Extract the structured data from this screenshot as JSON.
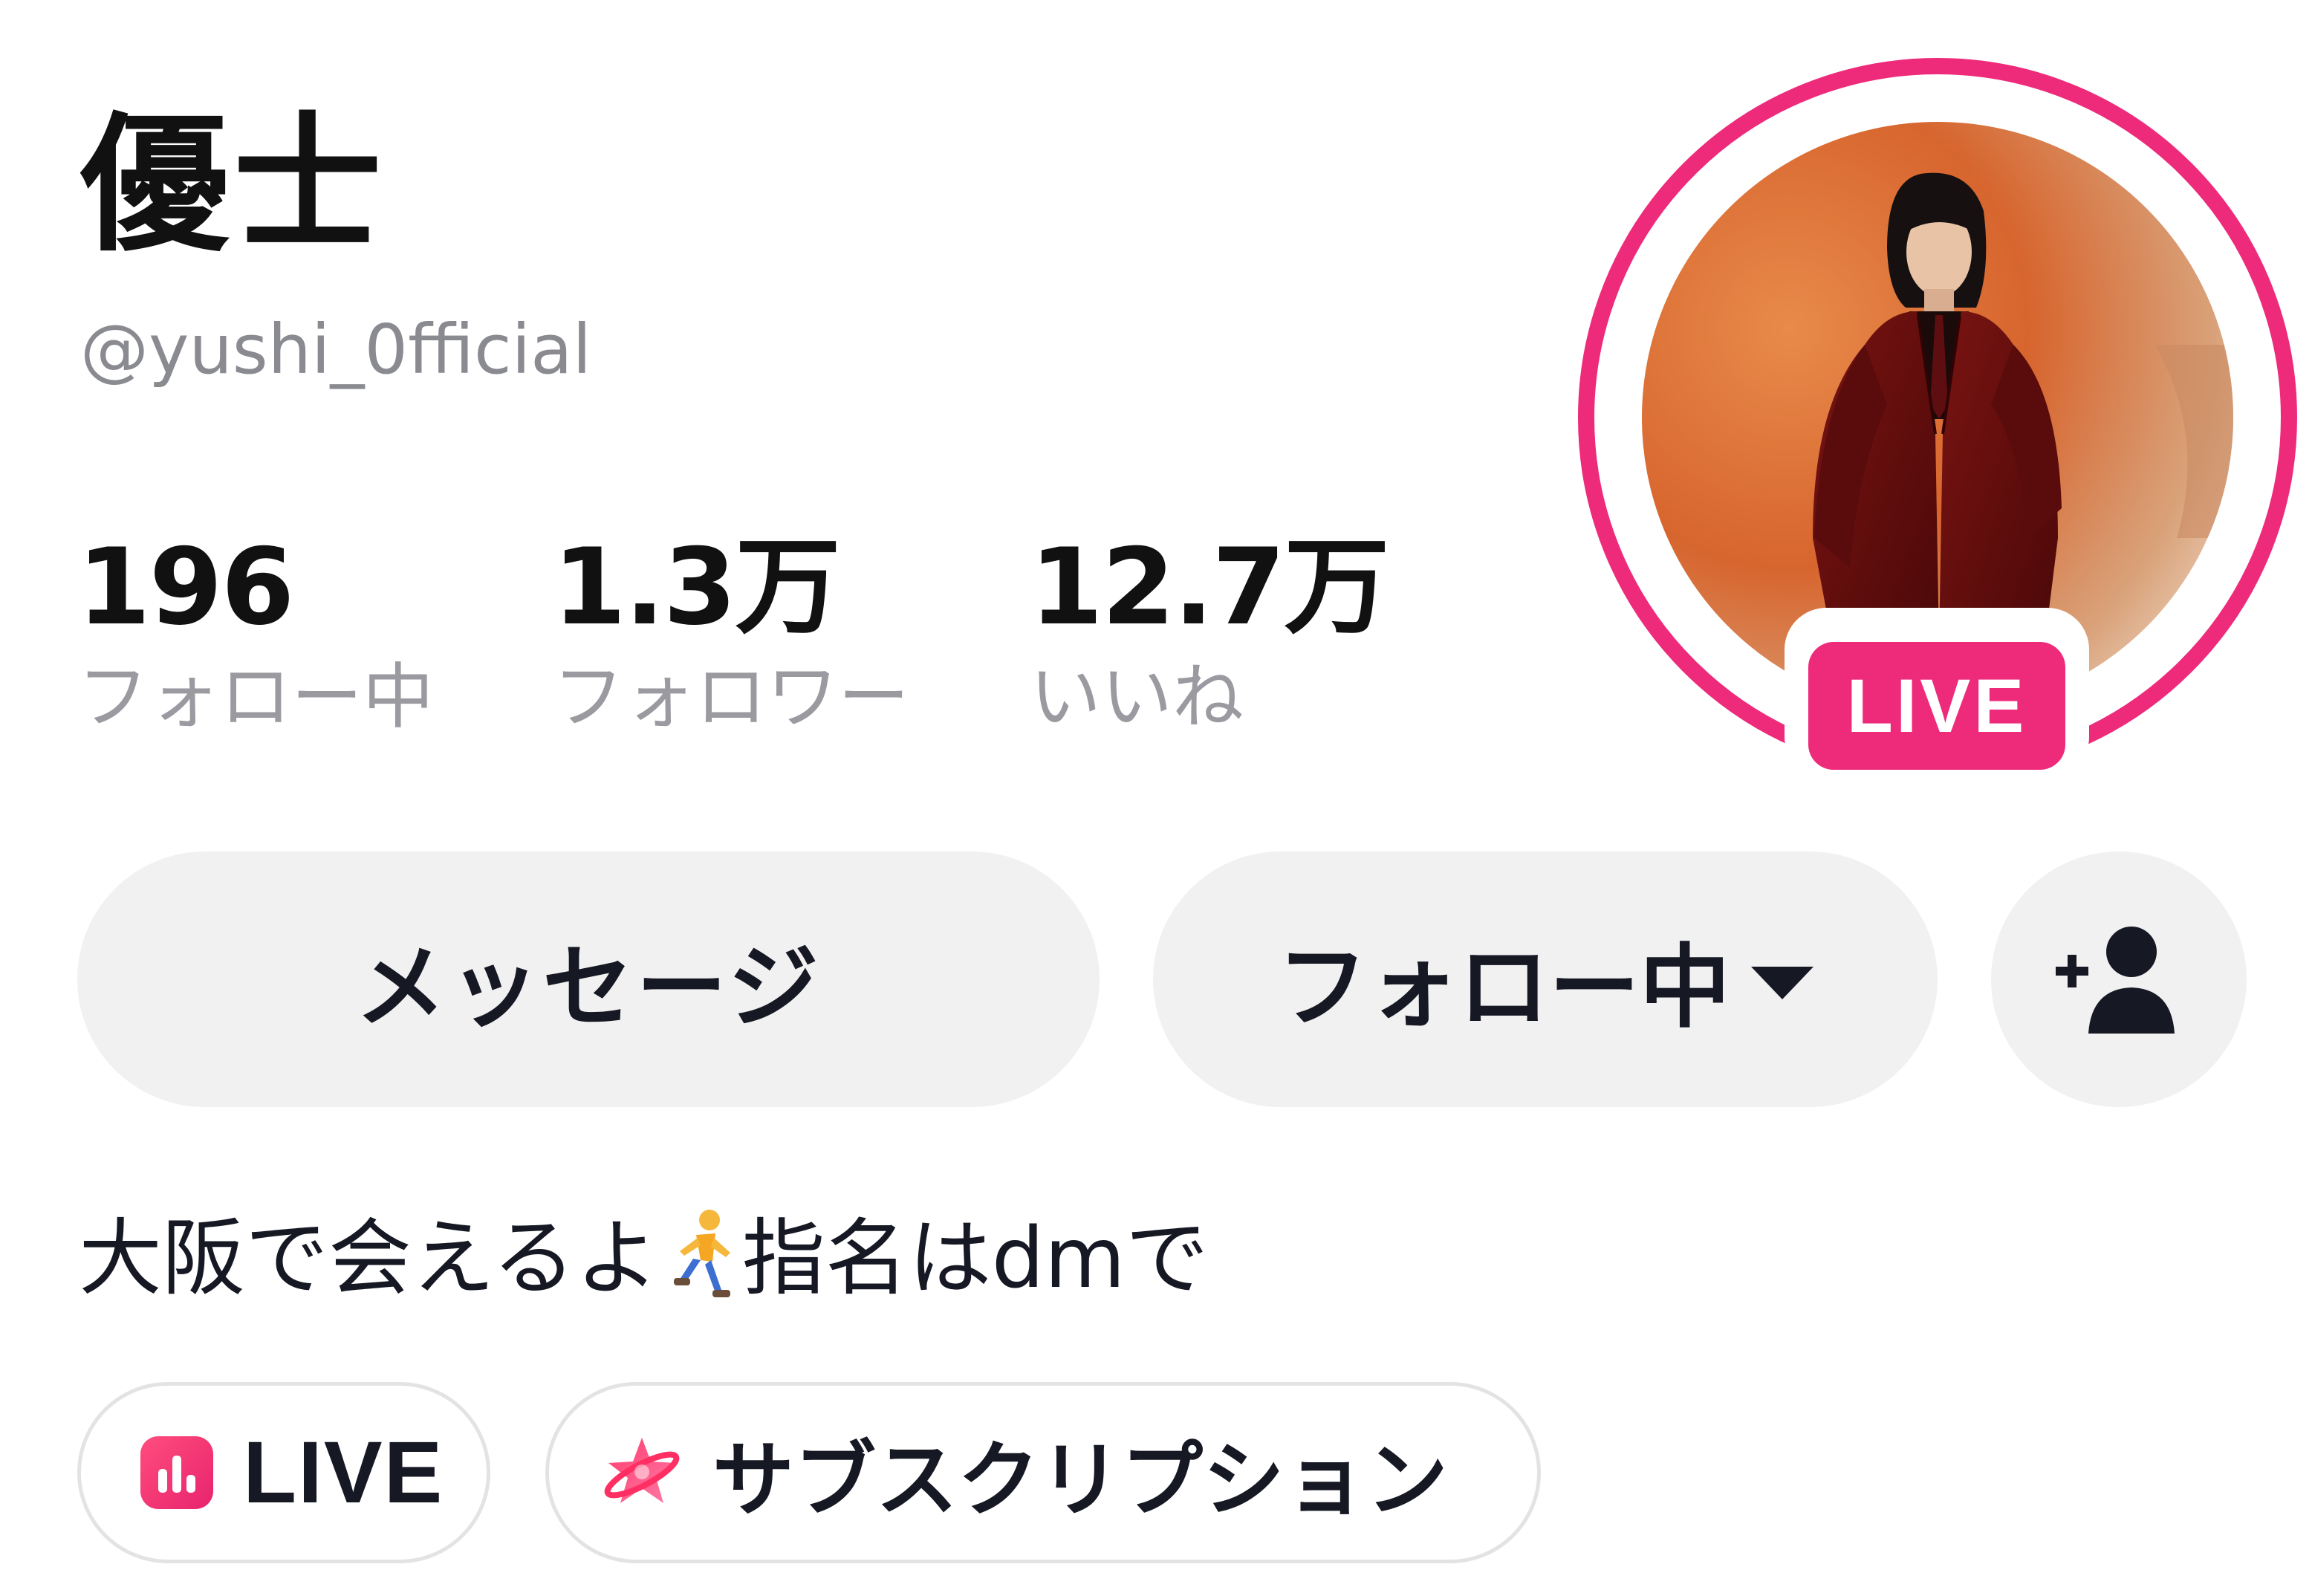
{
  "profile": {
    "display_name": "優士",
    "username": "@yushi_0fficial",
    "live_badge": "LIVE"
  },
  "stats": [
    {
      "value": "196",
      "label": "フォロー中"
    },
    {
      "value": "1.3万",
      "label": "フォロワー"
    },
    {
      "value": "12.7万",
      "label": "いいね"
    }
  ],
  "actions": {
    "message_label": "メッセージ",
    "following_label": "フォロー中",
    "add_friend_icon": "person-plus-icon"
  },
  "bio": {
    "before_emoji": "大阪で会えるよ",
    "emoji_icon": "runner-icon",
    "after_emoji": "指名はdmで"
  },
  "chips": {
    "live_label": "LIVE",
    "subscription_label": "サブスクリプション"
  },
  "colors": {
    "accent": "#ee2a7b",
    "button_bg": "#f1f1f2",
    "muted_text": "#8a8b91",
    "chip_border": "#e3e3e4"
  }
}
